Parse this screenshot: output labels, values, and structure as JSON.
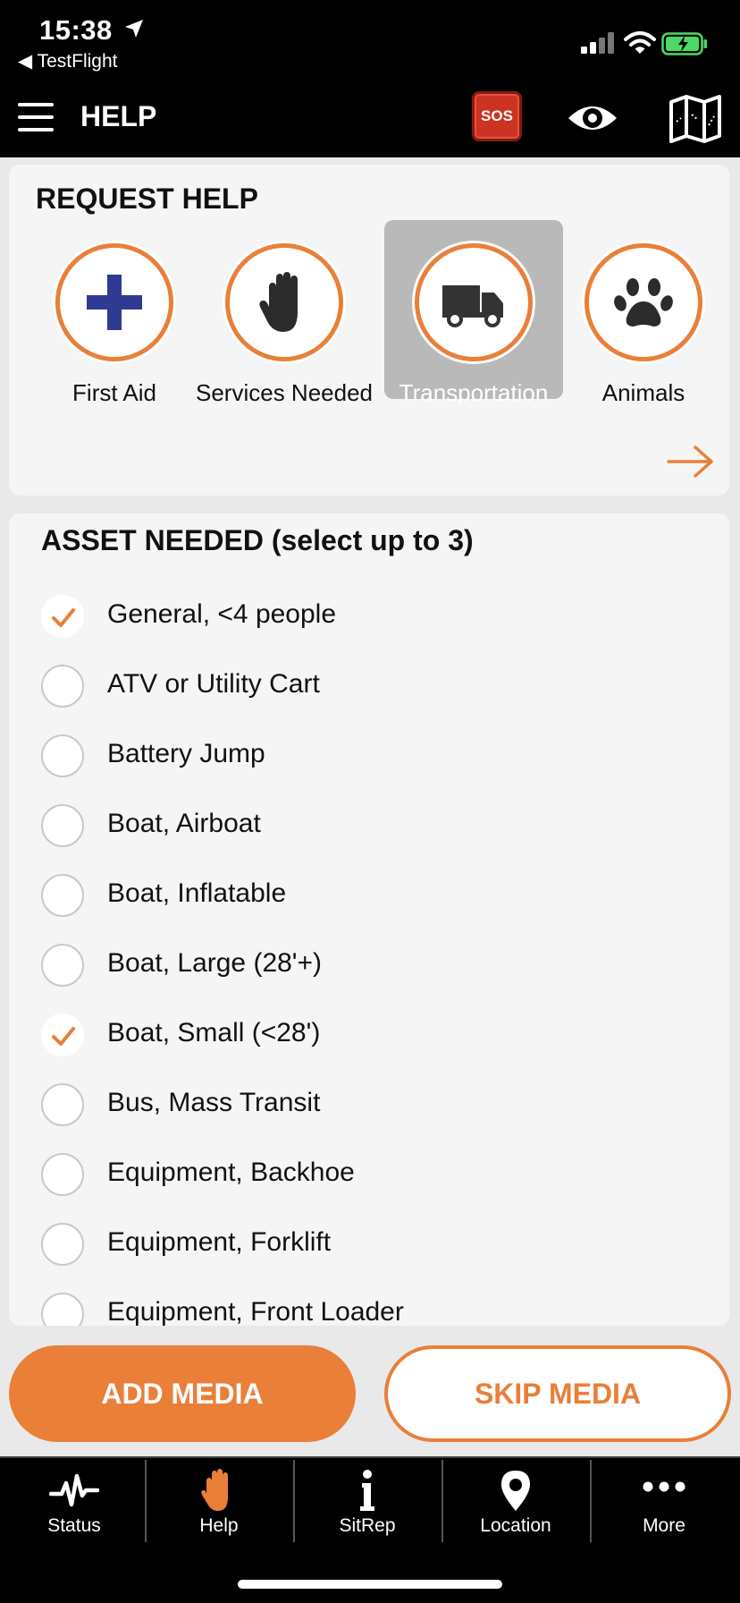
{
  "status_bar": {
    "time": "15:38",
    "back_app": "◀ TestFlight"
  },
  "header": {
    "title": "HELP",
    "sos_label": "SOS"
  },
  "request_help": {
    "title": "REQUEST HELP",
    "categories": [
      {
        "label": "First Aid",
        "icon": "plus-icon",
        "selected": false
      },
      {
        "label": "Services Needed",
        "icon": "hand-icon",
        "selected": false
      },
      {
        "label": "Transportation",
        "icon": "truck-icon",
        "selected": true
      },
      {
        "label": "Animals",
        "icon": "paw-icon",
        "selected": false
      }
    ]
  },
  "assets": {
    "title": "ASSET NEEDED (select up to 3)",
    "items": [
      {
        "label": "General, <4 people",
        "checked": true
      },
      {
        "label": "ATV or Utility Cart",
        "checked": false
      },
      {
        "label": "Battery Jump",
        "checked": false
      },
      {
        "label": "Boat, Airboat",
        "checked": false
      },
      {
        "label": "Boat, Inflatable",
        "checked": false
      },
      {
        "label": "Boat, Large (28'+)",
        "checked": false
      },
      {
        "label": "Boat, Small (<28')",
        "checked": true
      },
      {
        "label": "Bus, Mass Transit",
        "checked": false
      },
      {
        "label": "Equipment, Backhoe",
        "checked": false
      },
      {
        "label": "Equipment, Forklift",
        "checked": false
      },
      {
        "label": "Equipment, Front Loader",
        "checked": false
      }
    ]
  },
  "media": {
    "add_label": "ADD MEDIA",
    "skip_label": "SKIP MEDIA"
  },
  "tabs": [
    {
      "label": "Status",
      "icon": "pulse-icon"
    },
    {
      "label": "Help",
      "icon": "hand-icon"
    },
    {
      "label": "SitRep",
      "icon": "info-icon"
    },
    {
      "label": "Location",
      "icon": "pin-icon"
    },
    {
      "label": "More",
      "icon": "more-icon"
    }
  ],
  "colors": {
    "accent": "#e97f39",
    "sos": "#cc3322",
    "selected_tile": "#b9b9b9",
    "battery": "#4cd964"
  }
}
